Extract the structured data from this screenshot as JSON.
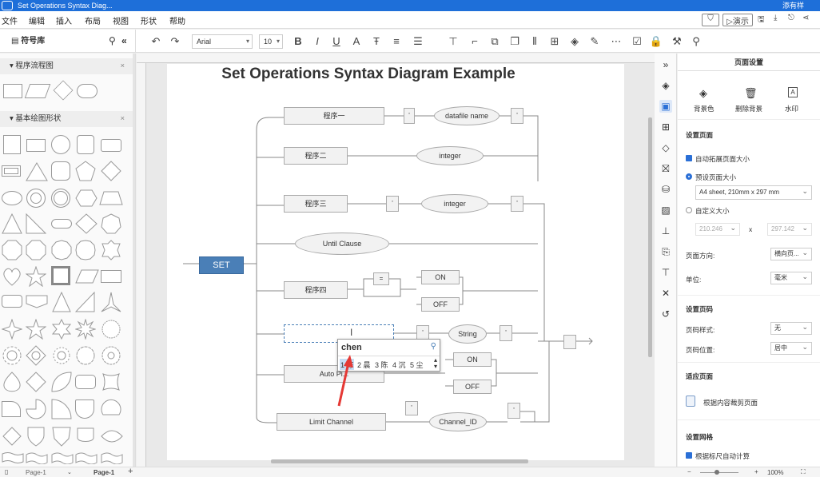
{
  "window": {
    "title": "Set Operations Syntax Diag...",
    "user": "添有样"
  },
  "menu": {
    "items": [
      "文件",
      "编辑",
      "插入",
      "布局",
      "视图",
      "形状",
      "帮助"
    ],
    "present_label": "演示"
  },
  "toolbar": {
    "library_title": "符号库",
    "font_family": "Arial",
    "font_size": "10"
  },
  "library": {
    "sections": [
      "程序流程图",
      "基本绘图形状"
    ]
  },
  "diagram": {
    "title": "Set Operations Syntax Diagram Example",
    "set_label": "SET",
    "rects": [
      "程序一",
      "程序二",
      "程序三",
      "程序四",
      "Auto Pi...",
      "Limit Channel"
    ],
    "ellipses": [
      "datafile name",
      "integer",
      "integer",
      "Until Clause",
      "String",
      "Channel_ID"
    ],
    "equals": "=",
    "on_label": "ON",
    "off_label": "OFF",
    "quote": "'"
  },
  "ime": {
    "input": "chen",
    "candidates": [
      "1 陈",
      "2 晨",
      "3 陈",
      "4 沉",
      "5 尘"
    ]
  },
  "right_panel": {
    "title": "页面设置",
    "tabs": [
      "背景色",
      "删除背景",
      "水印"
    ],
    "page_section": "设置页面",
    "auto_expand": "自动拓展页面大小",
    "preset_size": "预设页面大小",
    "paper_value": "A4 sheet, 210mm x 297 mm",
    "custom_size": "自定义大小",
    "width": "210.246",
    "height": "297.142",
    "x_sep": "x",
    "orientation_label": "页面方向:",
    "orientation_value": "横向页...",
    "unit_label": "单位:",
    "unit_value": "毫米",
    "pagenum_section": "设置页码",
    "pagenum_style_label": "页码样式:",
    "pagenum_style_value": "无",
    "pagenum_pos_label": "页码位置:",
    "pagenum_pos_value": "居中",
    "fit_section": "适应页面",
    "fit_btn": "根据内容裁剪页面",
    "grid_section": "设置网格",
    "grid_auto": "根据标尺自动计算"
  },
  "status": {
    "page_tab1": "Page-1",
    "page_tab2": "Page-1",
    "add": "+",
    "zoom": "100%"
  }
}
